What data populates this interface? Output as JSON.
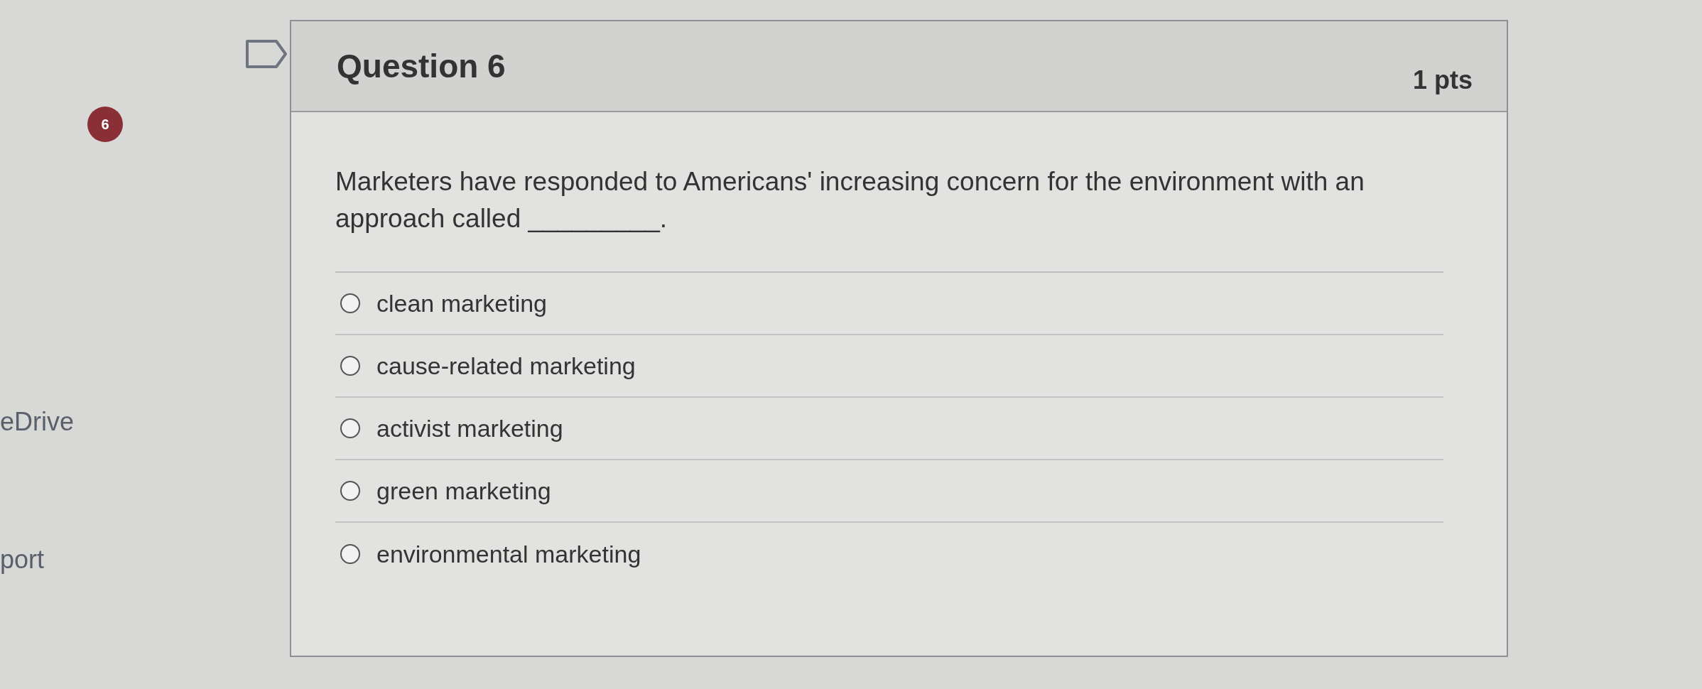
{
  "sidebar": {
    "items": [
      "eDrive",
      "port"
    ]
  },
  "question_badge": "6",
  "question": {
    "flagged": false,
    "title": "Question 6",
    "points": "1 pts",
    "text": "Marketers have responded to Americans' increasing concern for the environment with an approach called _________.",
    "options": [
      {
        "label": "clean marketing",
        "selected": false
      },
      {
        "label": "cause-related marketing",
        "selected": false
      },
      {
        "label": "activist marketing",
        "selected": false
      },
      {
        "label": "green marketing",
        "selected": false
      },
      {
        "label": "environmental marketing",
        "selected": false
      }
    ]
  }
}
